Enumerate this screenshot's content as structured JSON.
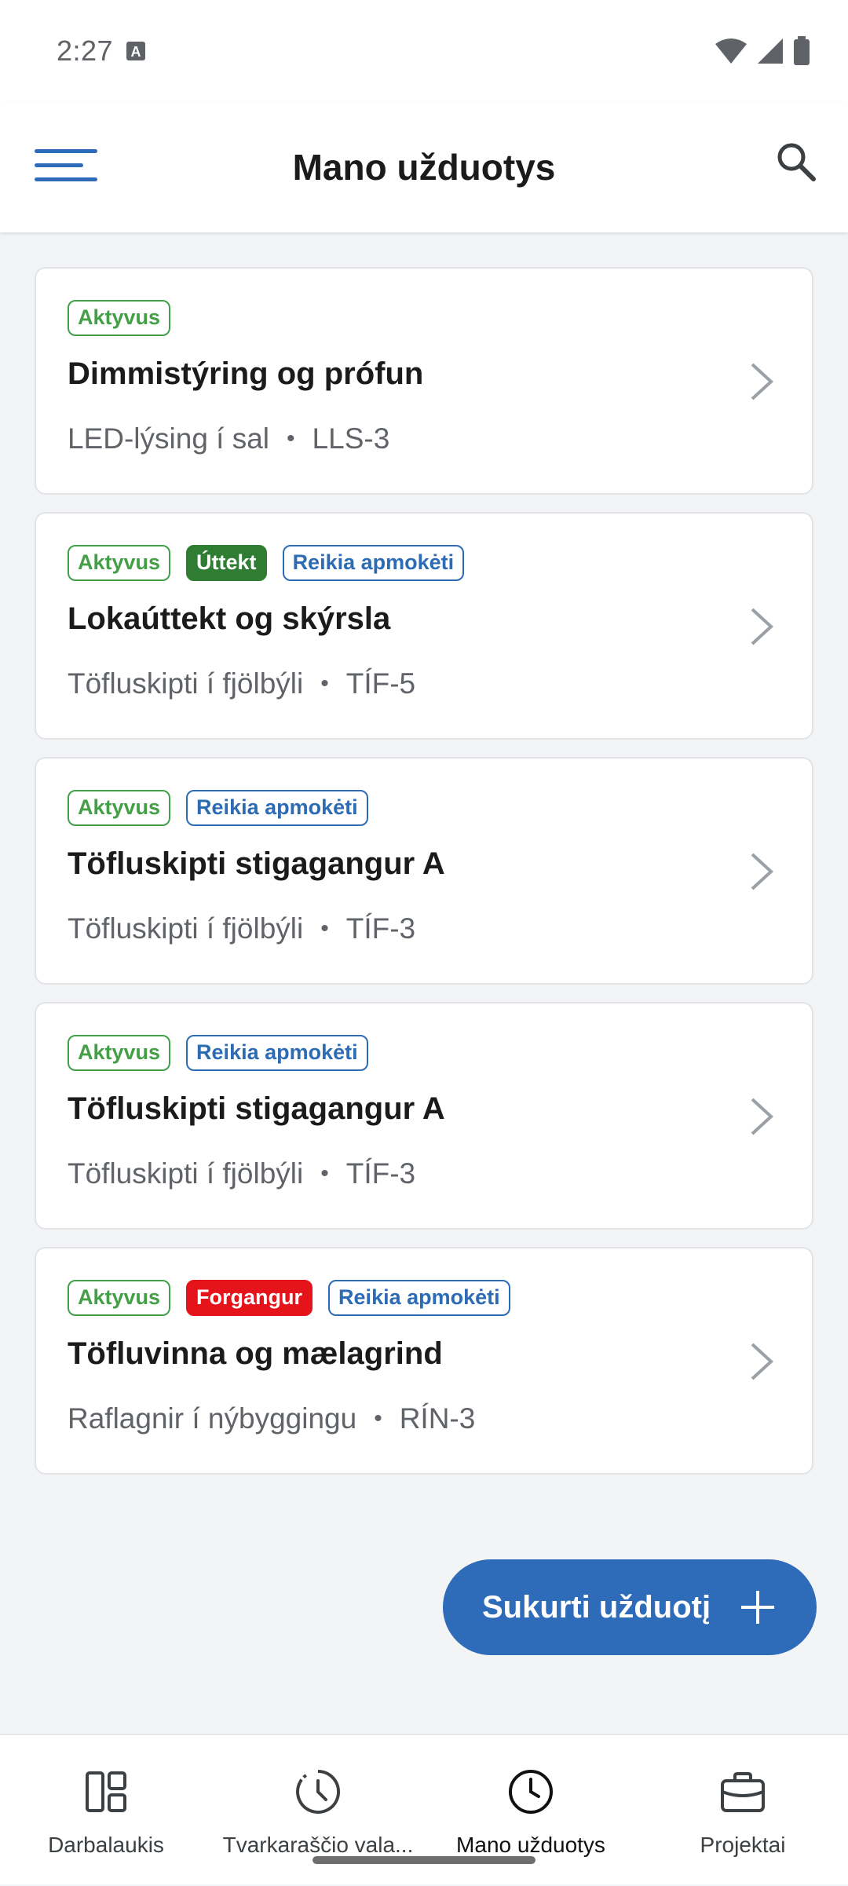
{
  "status": {
    "time": "2:27"
  },
  "header": {
    "title": "Mano užduotys"
  },
  "tasks": [
    {
      "badges": [
        {
          "label": "Aktyvus",
          "style": "outline-green"
        }
      ],
      "title": "Dimmistýring og prófun",
      "project": "LED-lýsing í sal",
      "code": "LLS-3"
    },
    {
      "badges": [
        {
          "label": "Aktyvus",
          "style": "outline-green"
        },
        {
          "label": "Úttekt",
          "style": "filled-green"
        },
        {
          "label": "Reikia apmokėti",
          "style": "outline-blue"
        }
      ],
      "title": "Lokaúttekt og skýrsla",
      "project": "Töfluskipti í fjölbýli",
      "code": "TÍF-5"
    },
    {
      "badges": [
        {
          "label": "Aktyvus",
          "style": "outline-green"
        },
        {
          "label": "Reikia apmokėti",
          "style": "outline-blue"
        }
      ],
      "title": "Töfluskipti stigagangur A",
      "project": "Töfluskipti í fjölbýli",
      "code": "TÍF-3"
    },
    {
      "badges": [
        {
          "label": "Aktyvus",
          "style": "outline-green"
        },
        {
          "label": "Reikia apmokėti",
          "style": "outline-blue"
        }
      ],
      "title": "Töfluskipti stigagangur A",
      "project": "Töfluskipti í fjölbýli",
      "code": "TÍF-3"
    },
    {
      "badges": [
        {
          "label": "Aktyvus",
          "style": "outline-green"
        },
        {
          "label": "Forgangur",
          "style": "filled-red"
        },
        {
          "label": "Reikia apmokėti",
          "style": "outline-blue"
        }
      ],
      "title": "Töfluvinna og mælagrind",
      "project": "Raflagnir í nýbyggingu",
      "code": "RÍN-3"
    }
  ],
  "fab": {
    "label": "Sukurti užduotį"
  },
  "bottom_nav": [
    {
      "label": "Darbalaukis",
      "icon": "dashboard-icon",
      "active": false
    },
    {
      "label": "Tvarkaraščio vala...",
      "icon": "timesheet-icon",
      "active": false
    },
    {
      "label": "Mano užduotys",
      "icon": "clock-icon",
      "active": true
    },
    {
      "label": "Projektai",
      "icon": "briefcase-icon",
      "active": false
    }
  ],
  "colors": {
    "accent": "#2e6bb8",
    "active_green": "#43a047",
    "inspection_green": "#2e7d32",
    "priority_red": "#e5141b",
    "payment_blue": "#2d6cb5"
  }
}
